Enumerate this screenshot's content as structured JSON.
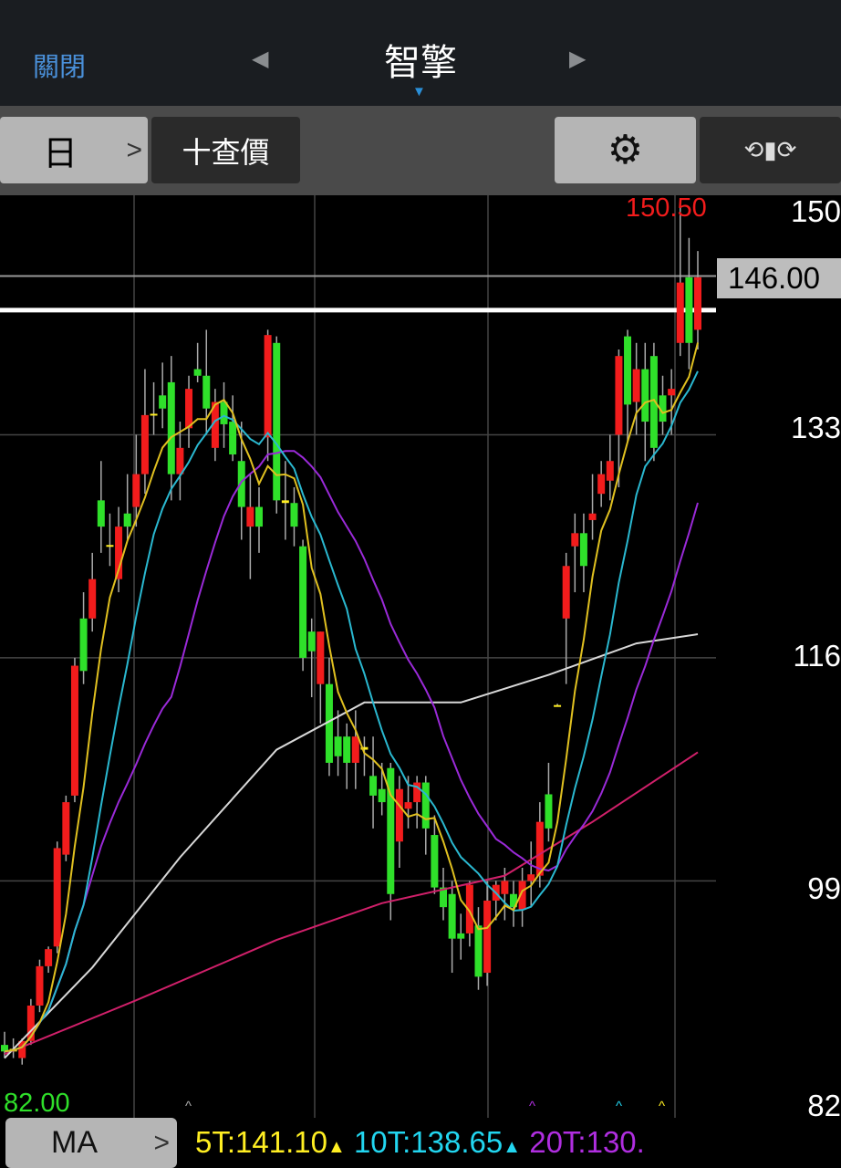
{
  "header": {
    "close_label": "關閉",
    "title": "智擎",
    "prev_icon": "◀",
    "next_icon": "▶"
  },
  "toolbar": {
    "period_label": "日",
    "chevron": ">",
    "quote_label": "十查價",
    "settings_icon": "gear-icon",
    "rotate_icon": "rotate-icon"
  },
  "axis": {
    "labels": [
      "150",
      "133",
      "116",
      "99",
      "82"
    ],
    "high_label": "150.50",
    "low_label": "82.00",
    "last_price": "146.00"
  },
  "ma_bar": {
    "button_label": "MA",
    "chevron": ">",
    "items": [
      {
        "label": "5T:141.10",
        "color": "#ffee22"
      },
      {
        "label": "10T:138.65",
        "color": "#22d6f0"
      },
      {
        "label": "20T:130.",
        "color": "#b02ee0"
      }
    ]
  },
  "colors": {
    "up": "#f21c1c",
    "down": "#2fe02a",
    "ma5": "#e0c020",
    "ma10": "#2ab8d0",
    "ma20": "#9a2ad8",
    "ma60": "#d8d8d8",
    "ma120": "#d0206a"
  },
  "chart_data": {
    "type": "candlestick",
    "ylim": [
      82,
      150
    ],
    "y_ticks": [
      150,
      133,
      116,
      99,
      82
    ],
    "reference_lines": [
      145.1,
      142.5
    ],
    "candles": [
      [
        86.5,
        87.5,
        85.5,
        86
      ],
      [
        86,
        87,
        85.5,
        86.2
      ],
      [
        85.5,
        87,
        85,
        86.8
      ],
      [
        86.8,
        90,
        86.5,
        89.5
      ],
      [
        89.5,
        93,
        89,
        92.5
      ],
      [
        92.5,
        94,
        92,
        93.8
      ],
      [
        94,
        102,
        93.5,
        101.5
      ],
      [
        101,
        105.5,
        100.5,
        105
      ],
      [
        105.5,
        116,
        105,
        115.4
      ],
      [
        119,
        121,
        114,
        115
      ],
      [
        119,
        124,
        118,
        122
      ],
      [
        128,
        131,
        124,
        126
      ],
      [
        124.5,
        127,
        123,
        124.6
      ],
      [
        122,
        127.5,
        121,
        126
      ],
      [
        127,
        130,
        125,
        126
      ],
      [
        127.5,
        133,
        126,
        130
      ],
      [
        130,
        138,
        128.5,
        134.5
      ],
      [
        134.5,
        137,
        133,
        134.6
      ],
      [
        136,
        138.5,
        133.5,
        135
      ],
      [
        137,
        139,
        128,
        130
      ],
      [
        130,
        134,
        128,
        132
      ],
      [
        133.5,
        137.5,
        132,
        136.5
      ],
      [
        138,
        140,
        137,
        137.5
      ],
      [
        137.5,
        141,
        133,
        135
      ],
      [
        132,
        136.5,
        131,
        135.5
      ],
      [
        135.5,
        137,
        132,
        133.8
      ],
      [
        134,
        136,
        131,
        131.5
      ],
      [
        131,
        134,
        125,
        127.5
      ],
      [
        126,
        130,
        122,
        127.5
      ],
      [
        127.5,
        129,
        124,
        126
      ],
      [
        132.8,
        141,
        131,
        140.6
      ],
      [
        140,
        140.5,
        127,
        128
      ],
      [
        128,
        131,
        125,
        127.8
      ],
      [
        127.8,
        129,
        124.5,
        126
      ],
      [
        124.5,
        125,
        115,
        116
      ],
      [
        118,
        119,
        113,
        116.5
      ],
      [
        114,
        118,
        111,
        118
      ],
      [
        114,
        116,
        107,
        108
      ],
      [
        110,
        112,
        107,
        108.5
      ],
      [
        110,
        111,
        106,
        108
      ],
      [
        108,
        112,
        106,
        110
      ],
      [
        109,
        110,
        107,
        109.2
      ],
      [
        107,
        110,
        103,
        105.5
      ],
      [
        106,
        108,
        104,
        105
      ],
      [
        107.6,
        108,
        96,
        98
      ],
      [
        102,
        107,
        100,
        106
      ],
      [
        104.5,
        107,
        103,
        105
      ],
      [
        105,
        107,
        103,
        106.5
      ],
      [
        106.5,
        107,
        101,
        103
      ],
      [
        102.5,
        104,
        98,
        98.5
      ],
      [
        98.5,
        100,
        96,
        97
      ],
      [
        98,
        99,
        92,
        94.6
      ],
      [
        95,
        96.5,
        93,
        94.6
      ],
      [
        95,
        99,
        94,
        98.7
      ],
      [
        95.6,
        97,
        90.7,
        91.7
      ],
      [
        92,
        99,
        91,
        97.5
      ],
      [
        97.5,
        99,
        96,
        98.7
      ],
      [
        98,
        100,
        96,
        99
      ],
      [
        98,
        99,
        95.5,
        97
      ],
      [
        96.8,
        100,
        95.5,
        99
      ],
      [
        99,
        102,
        97,
        99.5
      ],
      [
        99.4,
        105,
        98.5,
        103.5
      ],
      [
        105.6,
        108,
        102,
        103
      ],
      [
        112.4,
        112.5,
        112.3,
        112.4
      ],
      [
        119,
        124,
        114,
        123
      ],
      [
        124.5,
        127,
        121,
        125.5
      ],
      [
        125.5,
        127,
        121,
        123
      ],
      [
        126.5,
        130,
        125,
        127
      ],
      [
        128.5,
        131,
        127.5,
        130
      ],
      [
        129.5,
        133,
        128,
        131
      ],
      [
        133,
        139.5,
        129,
        139
      ],
      [
        140.5,
        141,
        132.5,
        135.3
      ],
      [
        135.5,
        140,
        133,
        138
      ],
      [
        138,
        140,
        131,
        134
      ],
      [
        139,
        140,
        131,
        132
      ],
      [
        136,
        137.5,
        133,
        134
      ],
      [
        136,
        138,
        133,
        136.5
      ],
      [
        140,
        150.5,
        139,
        144.6
      ],
      [
        145,
        148,
        138,
        140
      ],
      [
        141,
        147,
        139.5,
        145
      ]
    ],
    "ma60": [
      [
        0,
        85.5
      ],
      [
        10,
        92.4
      ],
      [
        20,
        100.8
      ],
      [
        31,
        109
      ],
      [
        41,
        112.6
      ],
      [
        52,
        112.6
      ],
      [
        62,
        114.7
      ],
      [
        72,
        117.1
      ],
      [
        79,
        117.8
      ]
    ],
    "ma120": [
      [
        0,
        85.8
      ],
      [
        15,
        89.9
      ],
      [
        31,
        94.5
      ],
      [
        43,
        97.3
      ],
      [
        57,
        99.4
      ],
      [
        67,
        103.5
      ],
      [
        79,
        108.8
      ]
    ]
  }
}
